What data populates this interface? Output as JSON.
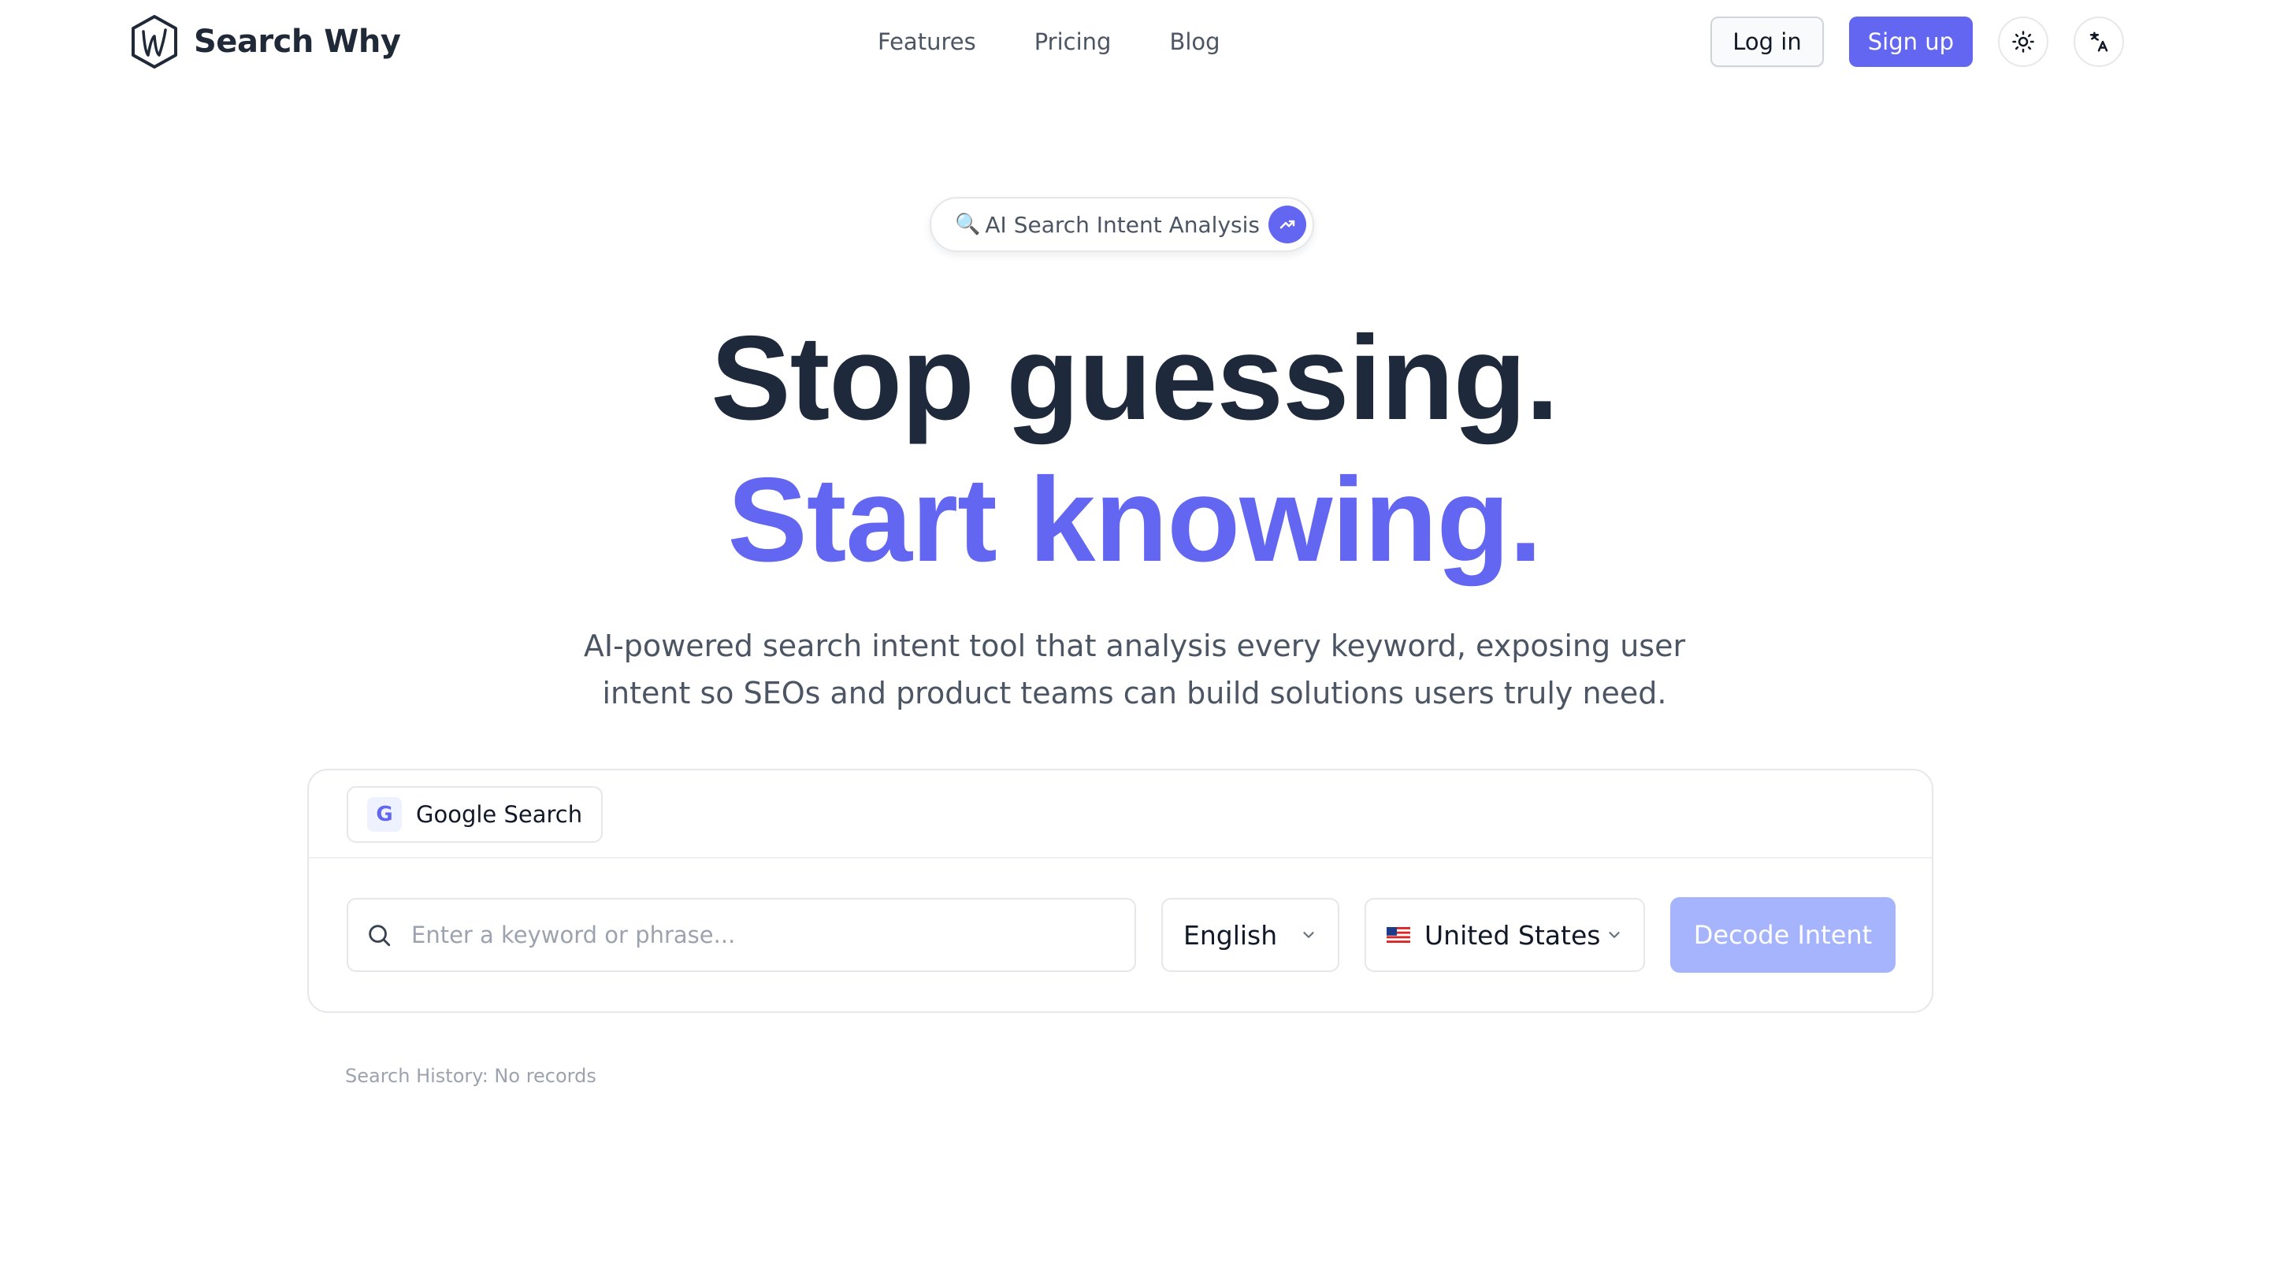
{
  "header": {
    "brand_name": "Search Why",
    "nav": [
      {
        "label": "Features"
      },
      {
        "label": "Pricing"
      },
      {
        "label": "Blog"
      }
    ],
    "login_label": "Log in",
    "signup_label": "Sign up",
    "theme_icon": "sun-icon",
    "language_icon": "translate-icon"
  },
  "hero": {
    "badge_text": "AI Search Intent Analysis",
    "badge_glass": "🔍",
    "headline_line1": "Stop guessing.",
    "headline_line2": "Start knowing.",
    "subtitle": "AI-powered search intent tool that analysis every keyword, exposing user intent so SEOs and product teams can build solutions users truly need."
  },
  "search_card": {
    "tab": {
      "icon_letter": "G",
      "label": "Google Search"
    },
    "input_placeholder": "Enter a keyword or phrase...",
    "input_value": "",
    "language_selected": "English",
    "country_selected": "United States",
    "submit_label": "Decode Intent"
  },
  "history_text": "Search History: No records",
  "colors": {
    "accent": "#6366f1",
    "accent_disabled": "#a5b4fc",
    "headline_dark": "#1e293b",
    "muted_text": "#4b5563"
  }
}
